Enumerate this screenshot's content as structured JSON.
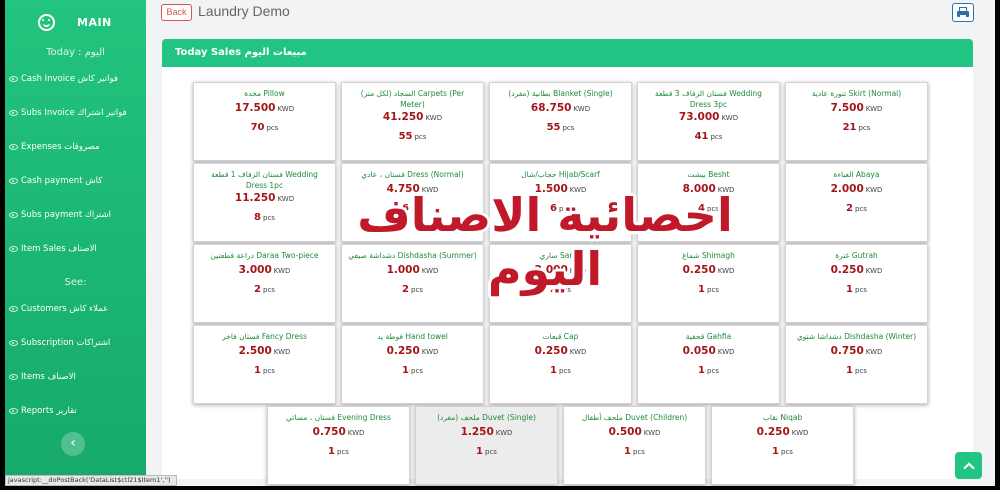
{
  "sidebar": {
    "brand": "MAIN",
    "today_label": "Today : اليوم",
    "items_today": [
      {
        "label": "Cash Invoice فواتير كاش"
      },
      {
        "label": "Subs Invoice فواتير اشتراك"
      },
      {
        "label": "Expenses مصروفات"
      },
      {
        "label": "Cash payment كاش"
      },
      {
        "label": "Subs payment اشتراك"
      },
      {
        "label": "Item Sales الاصناف"
      }
    ],
    "see_label": "See:",
    "items_see": [
      {
        "label": "Customers عملاء كاش"
      },
      {
        "label": "Subscription اشتراكات"
      },
      {
        "label": "Items الاصناف"
      },
      {
        "label": "Reports تقارير"
      }
    ],
    "collapse_icon": "‹"
  },
  "header": {
    "back_label": "Back",
    "title": "Laundry Demo",
    "print_icon": "printer-icon"
  },
  "card": {
    "title": "Today Sales مبيعات اليوم"
  },
  "currency": "KWD",
  "unit": "pcs",
  "items": [
    {
      "name": "مخدة Pillow",
      "price": "17.500",
      "qty": "70"
    },
    {
      "name": "السجاد (لكل متر) Carpets (Per Meter)",
      "price": "41.250",
      "qty": "55"
    },
    {
      "name": "بطانية (مفرد) Blanket (Single)",
      "price": "68.750",
      "qty": "55"
    },
    {
      "name": "فستان الزفاف 3 قطعة Wedding Dress 3pc",
      "price": "73.000",
      "qty": "41"
    },
    {
      "name": "تنورة عادية Skirt (Normal)",
      "price": "7.500",
      "qty": "21"
    },
    {
      "name": "فستان الزفاف 1 قطعة Wedding Dress 1pc",
      "price": "11.250",
      "qty": "8"
    },
    {
      "name": "فستان ، عادي Dress (Normal)",
      "price": "4.750",
      "qty": "6"
    },
    {
      "name": "حجاب/شال Hijab/Scarf",
      "price": "1.500",
      "qty": "6"
    },
    {
      "name": "بيشت Besht",
      "price": "8.000",
      "qty": "4"
    },
    {
      "name": "العباءة Abaya",
      "price": "2.000",
      "qty": "2"
    },
    {
      "name": "دراعة قطعتين Daraa Two-piece",
      "price": "3.000",
      "qty": "2"
    },
    {
      "name": "دشداشة صيفي Dishdasha (Summer)",
      "price": "1.000",
      "qty": "2"
    },
    {
      "name": "ساري Saree",
      "price": "2.000",
      "qty": "2"
    },
    {
      "name": "شماغ Shimagh",
      "price": "0.250",
      "qty": "1"
    },
    {
      "name": "غترة Gutrah",
      "price": "0.250",
      "qty": "1"
    },
    {
      "name": "فستان فاخر Fancy Dress",
      "price": "2.500",
      "qty": "1"
    },
    {
      "name": "فوطة يد Hand towel",
      "price": "0.250",
      "qty": "1"
    },
    {
      "name": "قبعات Cap",
      "price": "0.250",
      "qty": "1"
    },
    {
      "name": "قحفية Gahfia",
      "price": "0.050",
      "qty": "1"
    },
    {
      "name": "دشداشا شتوي Dishdasha (Winter)",
      "price": "0.750",
      "qty": "1"
    },
    {
      "name": "فستان ، مسائي Evening Dress",
      "price": "0.750",
      "qty": "1"
    },
    {
      "name": "ملحف (مفرد) Duvet (Single)",
      "price": "1.250",
      "qty": "1"
    },
    {
      "name": "ملحف أطفال Duvet (Children)",
      "price": "0.500",
      "qty": "1"
    },
    {
      "name": "نقاب Niqab",
      "price": "0.250",
      "qty": "1"
    }
  ],
  "overlay_text": "احصائية الاصناف اليوم",
  "status_bar": "javascript:__doPostBack('DataList$ctl21$Item1','')",
  "colors": {
    "accent": "#21c483",
    "price": "#a3161a",
    "item_name": "#1f8a3b",
    "overlay": "#c0192a"
  }
}
